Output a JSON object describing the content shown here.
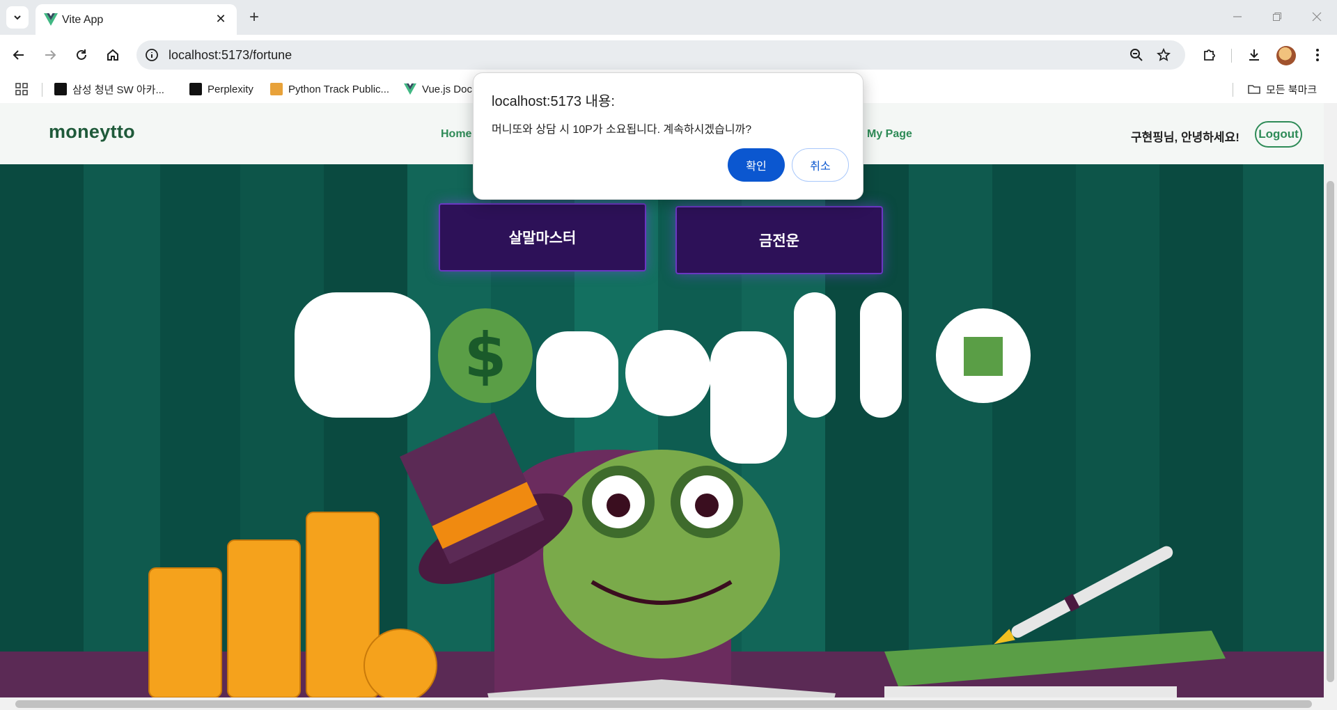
{
  "browser": {
    "tab_title": "Vite App",
    "url": "localhost:5173/fortune",
    "bookmarks": [
      {
        "label": "삼성 청년 SW 아카...",
        "icon": "samsung-icon"
      },
      {
        "label": "Perplexity",
        "icon": "perplexity-icon"
      },
      {
        "label": "Python Track Public...",
        "icon": "scroll-icon"
      },
      {
        "label": "Vue.js Doc",
        "icon": "vue-icon"
      }
    ],
    "all_bookmarks_label": "모든 북마크"
  },
  "site": {
    "logo": "moneytto",
    "nav": {
      "home": "Home",
      "mypage": "My Page"
    },
    "greeting": "구현핑님, 안녕하세요!",
    "logout_label": "Logout",
    "buttons": {
      "salmal": "살말마스터",
      "fortune": "금전운"
    },
    "hero_wordmark": "Moneytto"
  },
  "dialog": {
    "title": "localhost:5173 내용:",
    "message": "머니또와 상담 시 10P가 소요됩니다. 계속하시겠습니까?",
    "ok_label": "확인",
    "cancel_label": "취소"
  },
  "colors": {
    "brand_green": "#2e8b57",
    "hero_bg": "#05493f",
    "purple_button": "#2d1158",
    "dialog_primary": "#0b57d0"
  }
}
